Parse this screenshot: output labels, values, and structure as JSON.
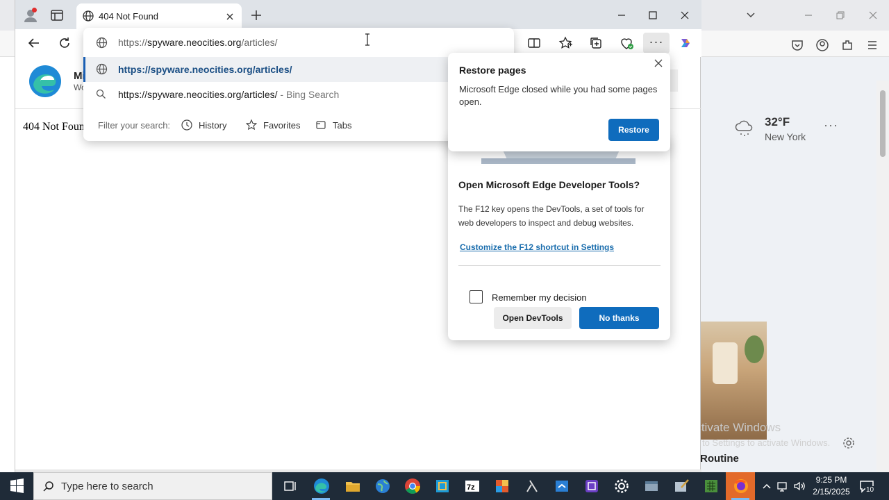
{
  "browser": {
    "tab": {
      "title": "404 Not Found"
    },
    "address_bar": {
      "url_prefix": "https://",
      "url_host": "spyware.neocities.org",
      "url_path": "/articles/"
    }
  },
  "omnibox": {
    "suggestion_url": "https://spyware.neocities.org/articles/",
    "search_suggestion_query": "https://spyware.neocities.org/articles/",
    "search_suggestion_suffix": " - Bing Search",
    "filter_label": "Filter your search:",
    "filters": [
      "History",
      "Favorites",
      "Tabs"
    ]
  },
  "page": {
    "brand_name": "Mi",
    "brand_sub": "Wo",
    "heading": "404 Not Foun"
  },
  "restore_flyout": {
    "title": "Restore pages",
    "body": "Microsoft Edge closed while you had some pages open.",
    "restore_label": "Restore"
  },
  "devtools_flyout": {
    "title": "Open Microsoft Edge Developer Tools?",
    "body": "The F12 key opens the DevTools, a set of tools for web developers to inspect and debug websites.",
    "link": "Customize the F12 shortcut in Settings",
    "checkbox_label": "Remember my decision",
    "open_label": "Open DevTools",
    "no_thanks_label": "No thanks"
  },
  "background_window": {
    "weather_temp": "32°F",
    "weather_city": "New York",
    "headline": "Routine",
    "watermark_line1": "Activate Windows",
    "watermark_line2": "Go to Settings to activate Windows."
  },
  "taskbar": {
    "search_placeholder": "Type here to search",
    "clock_time": "9:25 PM",
    "clock_date": "2/15/2025",
    "notification_count": "10"
  },
  "colors": {
    "accent": "#0f6cbd",
    "taskbar": "#1f2b38",
    "tabstrip": "#dfe3e8"
  }
}
